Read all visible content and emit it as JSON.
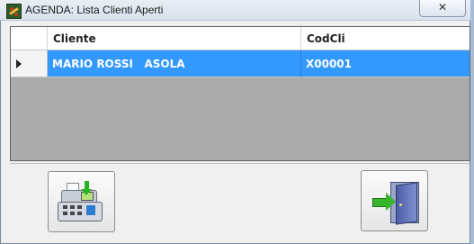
{
  "window": {
    "title": "AGENDA: Lista Clienti Aperti",
    "close_label": "✕",
    "icon": "agenda-app-icon"
  },
  "grid": {
    "columns": [
      "Cliente",
      "CodCli"
    ],
    "rows": [
      {
        "cliente": "MARIO ROSSI   ASOLA",
        "codcli": "X00001",
        "selected": true
      }
    ],
    "selection_color": "#3399ff",
    "empty_area_color": "#ababab"
  },
  "buttons": {
    "register": {
      "icon": "cash-register-icon"
    },
    "exit": {
      "icon": "exit-door-icon"
    }
  }
}
